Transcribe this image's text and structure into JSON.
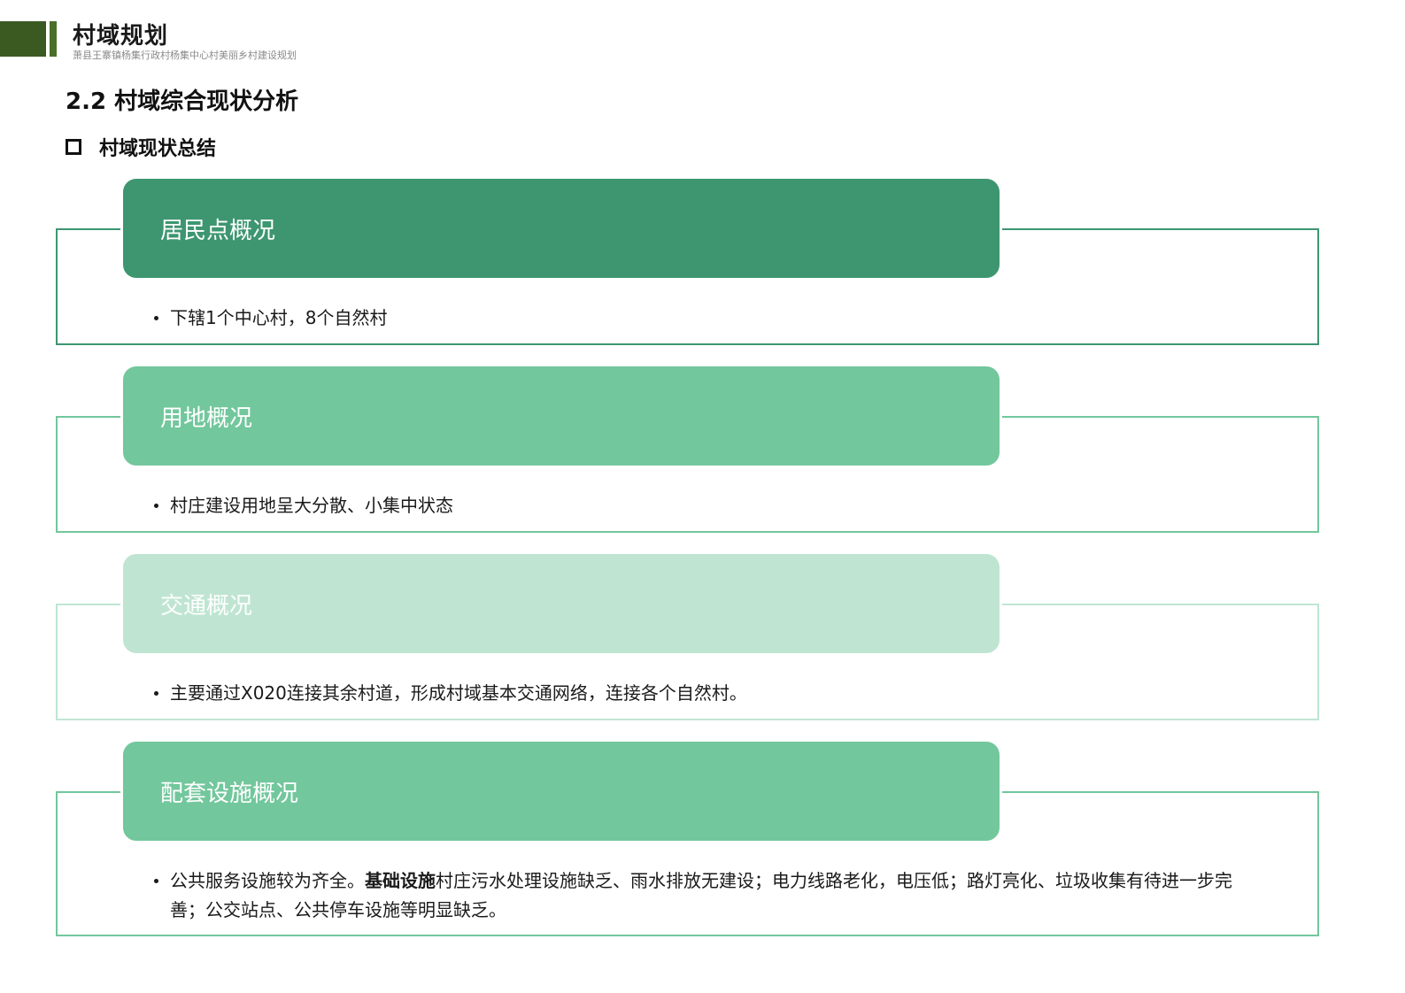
{
  "header": {
    "title": "村域规划",
    "subtitle": "萧县王寨镇杨集行政村杨集中心村美丽乡村建设规划"
  },
  "section_title": "2.2 村域综合现状分析",
  "subsection_title": "村域现状总结",
  "colors": {
    "header_block": "#3a5a22",
    "card_dark": "#3d9670",
    "card_mid": "#72c79c",
    "card_light": "#bfe5d2"
  },
  "cards": [
    {
      "heading": "居民点概况",
      "text": "下辖1个中心村，8个自然村"
    },
    {
      "heading": "用地概况",
      "text": "村庄建设用地呈大分散、小集中状态"
    },
    {
      "heading": "交通概况",
      "text": "主要通过X020连接其余村道，形成村域基本交通网络，连接各个自然村。"
    },
    {
      "heading": "配套设施概况",
      "text_pre": "公共服务设施较为齐全。",
      "text_bold": "基础设施",
      "text_post": "村庄污水处理设施缺乏、雨水排放无建设；电力线路老化，电压低；路灯亮化、垃圾收集有待进一步完善；公交站点、公共停车设施等明显缺乏。"
    }
  ]
}
